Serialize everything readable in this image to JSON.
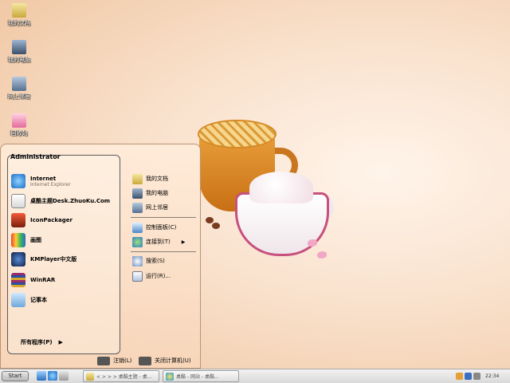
{
  "desktop": {
    "icons": [
      {
        "label": "我的文档",
        "icon": "folder-documents-icon"
      },
      {
        "label": "我的电脑",
        "icon": "computer-icon"
      },
      {
        "label": "网上邻居",
        "icon": "network-icon"
      },
      {
        "label": "回收站",
        "icon": "recycle-bin-icon"
      }
    ]
  },
  "start_menu": {
    "user": "Administrator",
    "left_items": [
      {
        "title": "Internet",
        "subtitle": "Internet Explorer",
        "icon": "internet-explorer-icon"
      },
      {
        "title": "桌酷主题Desk.ZhuoKu.Com",
        "subtitle": "",
        "icon": "zhuoku-theme-icon"
      },
      {
        "title": "IconPackager",
        "subtitle": "",
        "icon": "iconpackager-icon"
      },
      {
        "title": "画图",
        "subtitle": "",
        "icon": "paint-icon"
      },
      {
        "title": "KMPlayer中文版",
        "subtitle": "",
        "icon": "kmplayer-icon"
      },
      {
        "title": "WinRAR",
        "subtitle": "",
        "icon": "winrar-icon"
      },
      {
        "title": "记事本",
        "subtitle": "",
        "icon": "notepad-icon"
      }
    ],
    "all_programs": "所有程序(P)",
    "all_programs_arrow": "▶",
    "right_items": [
      {
        "label": "我的文档",
        "icon": "my-documents-icon"
      },
      {
        "label": "我的电脑",
        "icon": "my-computer-icon"
      },
      {
        "label": "网上邻居",
        "icon": "network-places-icon"
      },
      {
        "label": "控制面板(C)",
        "icon": "control-panel-icon"
      },
      {
        "label": "连接到(T)",
        "icon": "connect-to-icon",
        "submenu": "▶"
      },
      {
        "label": "搜索(S)",
        "icon": "search-icon"
      },
      {
        "label": "运行(R)...",
        "icon": "run-icon"
      }
    ],
    "logoff": "注销(L)",
    "shutdown": "关闭计算机(U)"
  },
  "taskbar": {
    "start": "Start",
    "tasks": [
      {
        "label": "< > > > 桌酷主题 - 桌...",
        "icon": "folder-task-icon"
      },
      {
        "label": "桌酷 - 网站 - 桌酷...",
        "icon": "browser-task-icon"
      }
    ],
    "clock": "22:34"
  },
  "colors": {
    "background": "#f9e1cc",
    "menu_border": "#5b5b5b",
    "taskbar": "#e0e0e0"
  }
}
